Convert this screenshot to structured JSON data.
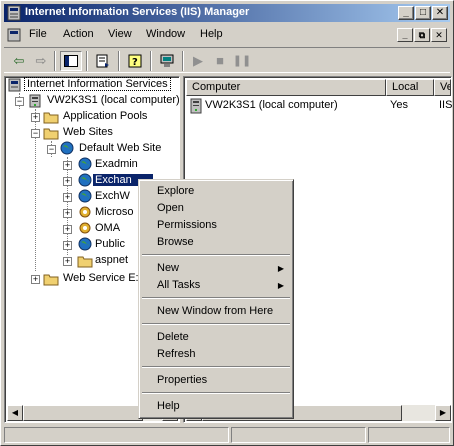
{
  "window": {
    "title": "Internet Information Services (IIS) Manager"
  },
  "menubar": {
    "items": [
      "File",
      "Action",
      "View",
      "Window",
      "Help"
    ]
  },
  "tree": {
    "root": "Internet Information Services",
    "computer": "VW2K3S1 (local computer)",
    "app_pools": "Application Pools",
    "web_sites": "Web Sites",
    "default_site": "Default Web Site",
    "children": [
      "Exadmin",
      "Exchange",
      "ExchWeb",
      "Microsoft-Server-ActiveSync",
      "OMA",
      "Public",
      "aspnet_client"
    ],
    "children_visible": [
      "Exadmin",
      "Exchan",
      "ExchW",
      "Microso",
      "OMA",
      "Public",
      "aspnet"
    ],
    "web_service_ext": "Web Service Extensions",
    "web_service_ext_visible": "Web Service E:"
  },
  "listview": {
    "columns": [
      "Computer",
      "Local",
      "Ve"
    ],
    "rows": [
      {
        "computer": "VW2K3S1 (local computer)",
        "local": "Yes",
        "version": "IIS"
      }
    ]
  },
  "context_menu": {
    "group1": [
      "Explore",
      "Open",
      "Permissions",
      "Browse"
    ],
    "group2": [
      "New",
      "All Tasks"
    ],
    "group3": [
      "New Window from Here"
    ],
    "group4": [
      "Delete",
      "Refresh"
    ],
    "group5": [
      "Properties"
    ],
    "group6": [
      "Help"
    ]
  },
  "colors": {
    "title_start": "#0a246a",
    "title_end": "#a6caf0",
    "selection": "#0a246a",
    "face": "#d4d0c8"
  }
}
